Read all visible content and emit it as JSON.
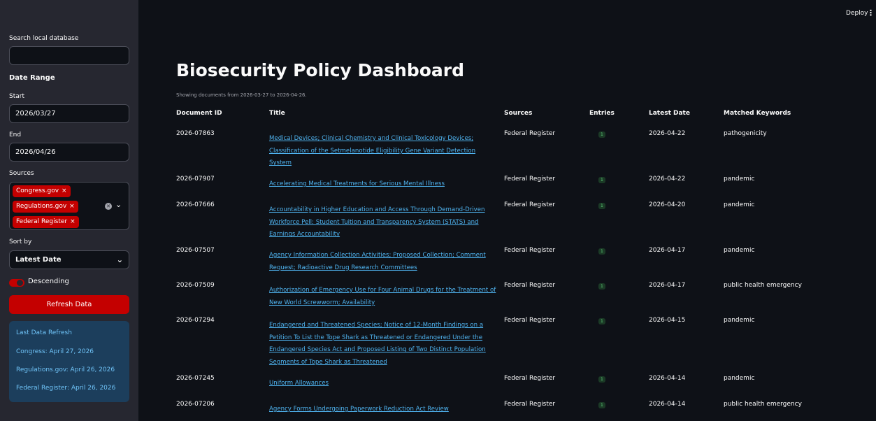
{
  "sidebar": {
    "search_label": "Search local database",
    "search_value": "",
    "date_range_label": "Date Range",
    "start_label": "Start",
    "start_value": "2026/03/27",
    "end_label": "End",
    "end_value": "2026/04/26",
    "sources_label": "Sources",
    "source_tags": [
      "Congress.gov",
      "Regulations.gov",
      "Federal Register"
    ],
    "tag_remove_glyph": "×",
    "sort_label": "Sort by",
    "sort_value": "Latest Date",
    "descending_label": "Descending",
    "descending_on": true,
    "refresh_label": "Refresh Data",
    "last_refresh": {
      "title": "Last Data Refresh",
      "congress": "Congress: April 27, 2026",
      "regulations": "Regulations.gov: April 26, 2026",
      "federal_register": "Federal Register: April 26, 2026"
    }
  },
  "toolbar": {
    "deploy_label": "Deploy",
    "menu_glyph": "⋮"
  },
  "main": {
    "title": "Biosecurity Policy Dashboard",
    "subtitle": "Showing documents from 2026-03-27 to 2026-04-26.",
    "columns": [
      "Document ID",
      "Title",
      "Sources",
      "Entries",
      "Latest Date",
      "Matched Keywords"
    ],
    "rows": [
      {
        "id": "2026-07863",
        "title": "Medical Devices; Clinical Chemistry and Clinical Toxicology Devices; Classification of the Setmelanotide Eligibility Gene Variant Detection System",
        "sources": "Federal Register",
        "entries": "1",
        "date": "2026-04-22",
        "keywords": "pathogenicity"
      },
      {
        "id": "2026-07907",
        "title": "Accelerating Medical Treatments for Serious Mental Illness",
        "sources": "Federal Register",
        "entries": "1",
        "date": "2026-04-22",
        "keywords": "pandemic"
      },
      {
        "id": "2026-07666",
        "title": "Accountability in Higher Education and Access Through Demand-Driven Workforce Pell: Student Tuition and Transparency System (STATS) and Earnings Accountability",
        "sources": "Federal Register",
        "entries": "1",
        "date": "2026-04-20",
        "keywords": "pandemic"
      },
      {
        "id": "2026-07507",
        "title": "Agency Information Collection Activities; Proposed Collection; Comment Request; Radioactive Drug Research Committees",
        "sources": "Federal Register",
        "entries": "1",
        "date": "2026-04-17",
        "keywords": "pandemic"
      },
      {
        "id": "2026-07509",
        "title": "Authorization of Emergency Use for Four Animal Drugs for the Treatment of New World Screwworm; Availability",
        "sources": "Federal Register",
        "entries": "1",
        "date": "2026-04-17",
        "keywords": "public health emergency"
      },
      {
        "id": "2026-07294",
        "title": "Endangered and Threatened Species; Notice of 12-Month Findings on a Petition To List the Tope Shark as Threatened or Endangered Under the Endangered Species Act and Proposed Listing of Two Distinct Population Segments of Tope Shark as Threatened",
        "sources": "Federal Register",
        "entries": "1",
        "date": "2026-04-15",
        "keywords": "pandemic"
      },
      {
        "id": "2026-07245",
        "title": "Uniform Allowances",
        "sources": "Federal Register",
        "entries": "1",
        "date": "2026-04-14",
        "keywords": "pandemic"
      },
      {
        "id": "2026-07206",
        "title": "Agency Forms Undergoing Paperwork Reduction Act Review",
        "sources": "Federal Register",
        "entries": "1",
        "date": "2026-04-14",
        "keywords": "public health emergency"
      }
    ]
  }
}
